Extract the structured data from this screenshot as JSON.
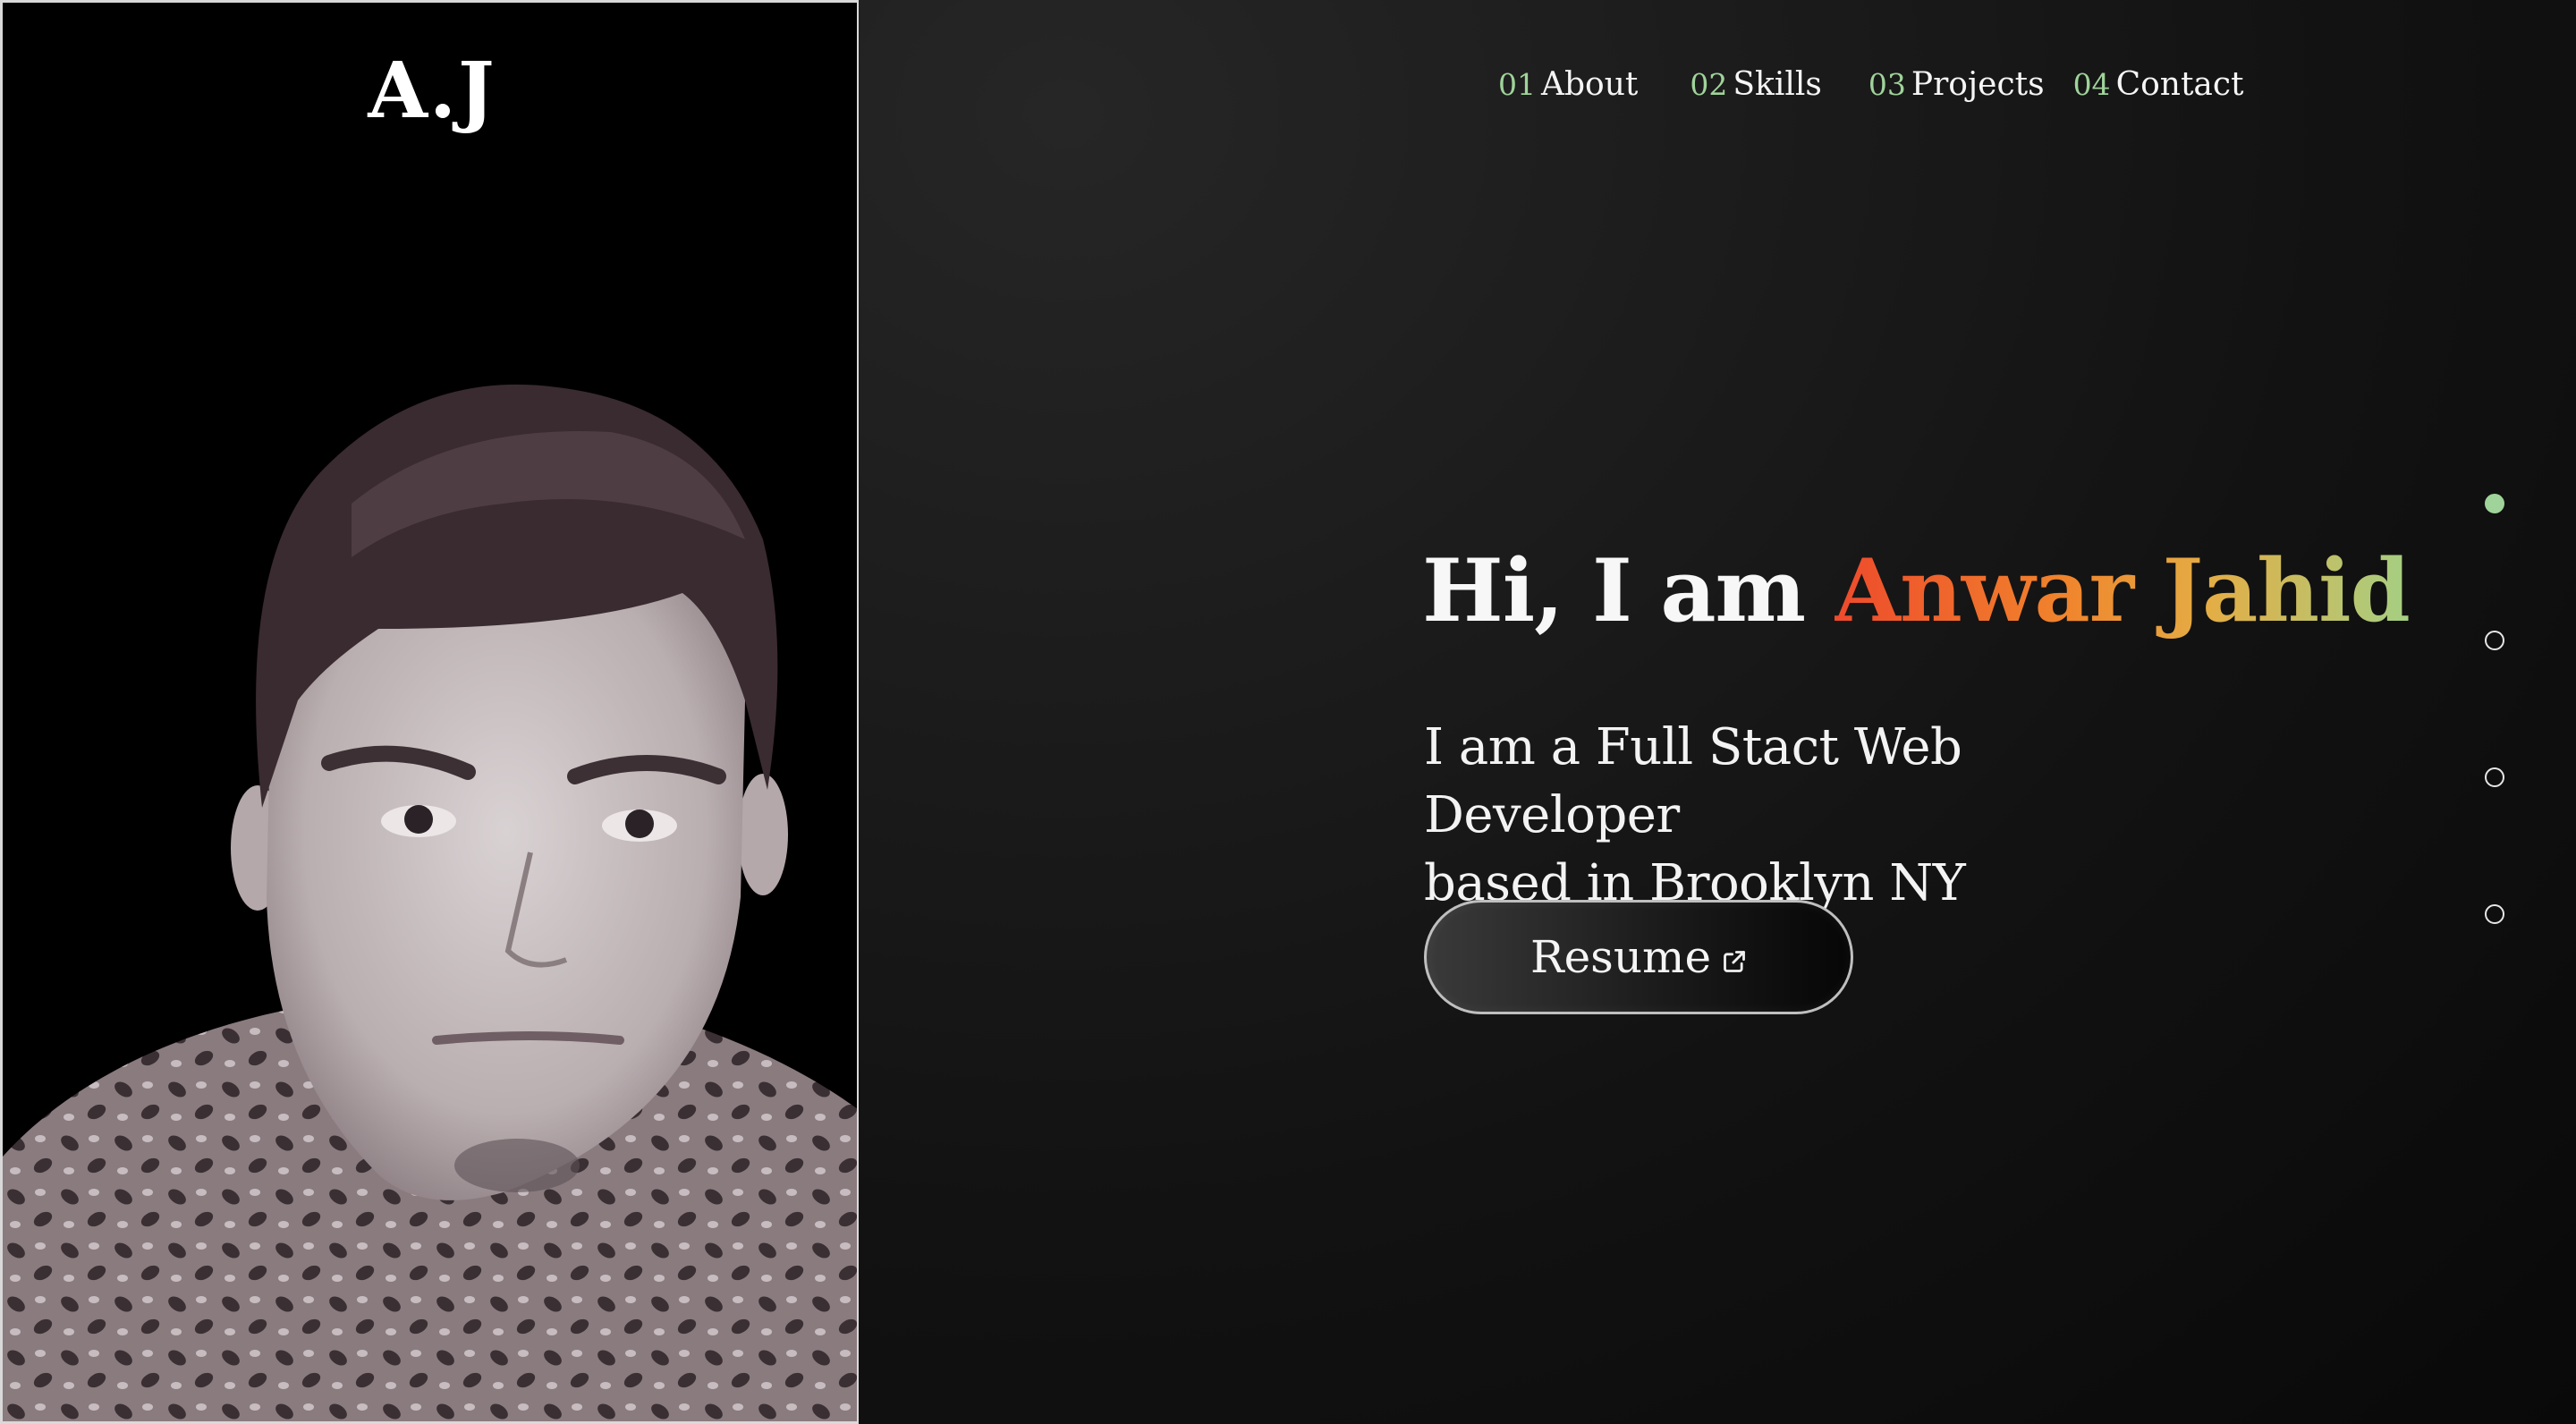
{
  "brand": {
    "logo_text": "A.J"
  },
  "nav": {
    "items": [
      {
        "num": "01",
        "label": "About"
      },
      {
        "num": "02",
        "label": "Skills"
      },
      {
        "num": "03",
        "label": "Projects"
      },
      {
        "num": "04",
        "label": "Contact"
      }
    ]
  },
  "hero": {
    "greeting_prefix": "Hi, I am ",
    "name": "Anwar Jahid",
    "tagline_line1": "I am a Full Stact Web Developer",
    "tagline_line2": "based in Brooklyn NY",
    "resume_label": "Resume",
    "resume_icon": "external-link-icon"
  },
  "section_dots": {
    "count": 4,
    "active_index": 0
  },
  "colors": {
    "accent_green": "#9fd39a",
    "name_gradient": [
      "#ee4a2c",
      "#f0842c",
      "#e4ad45",
      "#a5cf83"
    ],
    "background": "#121212"
  },
  "icons": {
    "portrait": "profile-photo"
  }
}
